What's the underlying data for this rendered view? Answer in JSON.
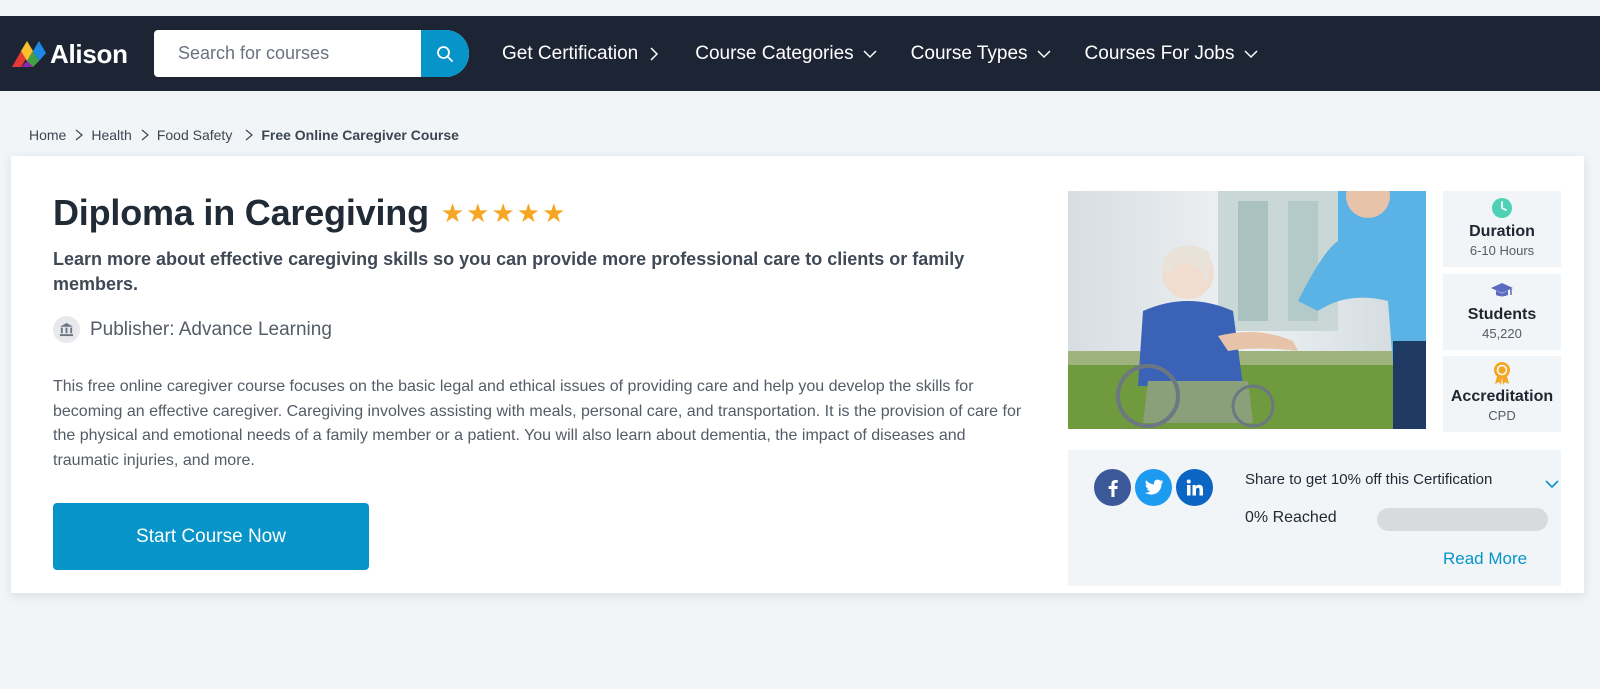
{
  "brand": {
    "name": "Alison",
    "accent": "#0795c9",
    "nav_bg": "#1d2433",
    "star_color": "#f5a623"
  },
  "search": {
    "placeholder": "Search for courses",
    "value": "",
    "icon": "search-icon"
  },
  "nav": {
    "items": [
      {
        "label": "Get Certification",
        "icon": "chevron-right-icon"
      },
      {
        "label": "Course Categories",
        "icon": "chevron-down-icon"
      },
      {
        "label": "Course Types",
        "icon": "chevron-down-icon"
      },
      {
        "label": "Courses For Jobs",
        "icon": "chevron-down-icon"
      }
    ]
  },
  "breadcrumb": {
    "items": [
      "Home",
      "Health",
      "Food Safety"
    ],
    "current": "Free Online Caregiver Course"
  },
  "course": {
    "title": "Diploma in Caregiving",
    "rating_stars": 5,
    "subtitle": "Learn more about effective caregiving skills so you can provide more professional care to clients or family members.",
    "publisher": "Publisher: Advance Learning",
    "description": "This free online caregiver course focuses on the basic legal and ethical issues of providing care and help you develop the skills for becoming an effective caregiver. Caregiving involves assisting with meals, personal care, and transportation. It is the provision of care for the physical and emotional needs of a family member or a patient. You will also learn about dementia, the impact of diseases and traumatic injuries, and more.",
    "cta_label": "Start Course Now"
  },
  "stats": [
    {
      "label": "Duration",
      "value": "6-10 Hours",
      "icon": "clock-icon",
      "color": "#4fd1b5"
    },
    {
      "label": "Students",
      "value": "45,220",
      "icon": "graduation-cap-icon",
      "color": "#5b6bc0"
    },
    {
      "label": "Accreditation",
      "value": "CPD",
      "icon": "award-badge-icon",
      "color": "#f5a623"
    }
  ],
  "share": {
    "text": "Share to get 10% off this Certification",
    "reached_label": "0% Reached",
    "progress_percent": 0,
    "read_more": "Read More",
    "networks": [
      "facebook",
      "twitter",
      "linkedin"
    ]
  }
}
